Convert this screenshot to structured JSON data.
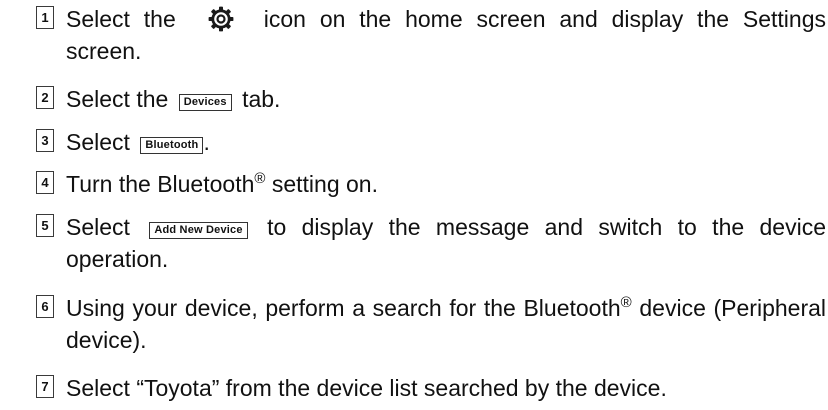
{
  "steps": [
    {
      "num": "1",
      "before": "Select the",
      "icon": "gear-icon",
      "after": "icon on the home screen and display the Settings screen."
    },
    {
      "num": "2",
      "before": "Select the",
      "button": "Devices",
      "after": "tab."
    },
    {
      "num": "3",
      "before": "Select",
      "button": "Bluetooth",
      "after": "."
    },
    {
      "num": "4",
      "before": "Turn the Bluetooth",
      "sup": "®",
      "after": "setting on."
    },
    {
      "num": "5",
      "before": "Select",
      "button": "Add New Device",
      "after": "to display the message and switch to the device operation."
    },
    {
      "num": "6",
      "before": "Using your device, perform a search for the Bluetooth",
      "sup": "®",
      "after": "device (Peripheral device)."
    },
    {
      "num": "7",
      "text": "Select “Toyota” from the device list searched by the device."
    }
  ]
}
